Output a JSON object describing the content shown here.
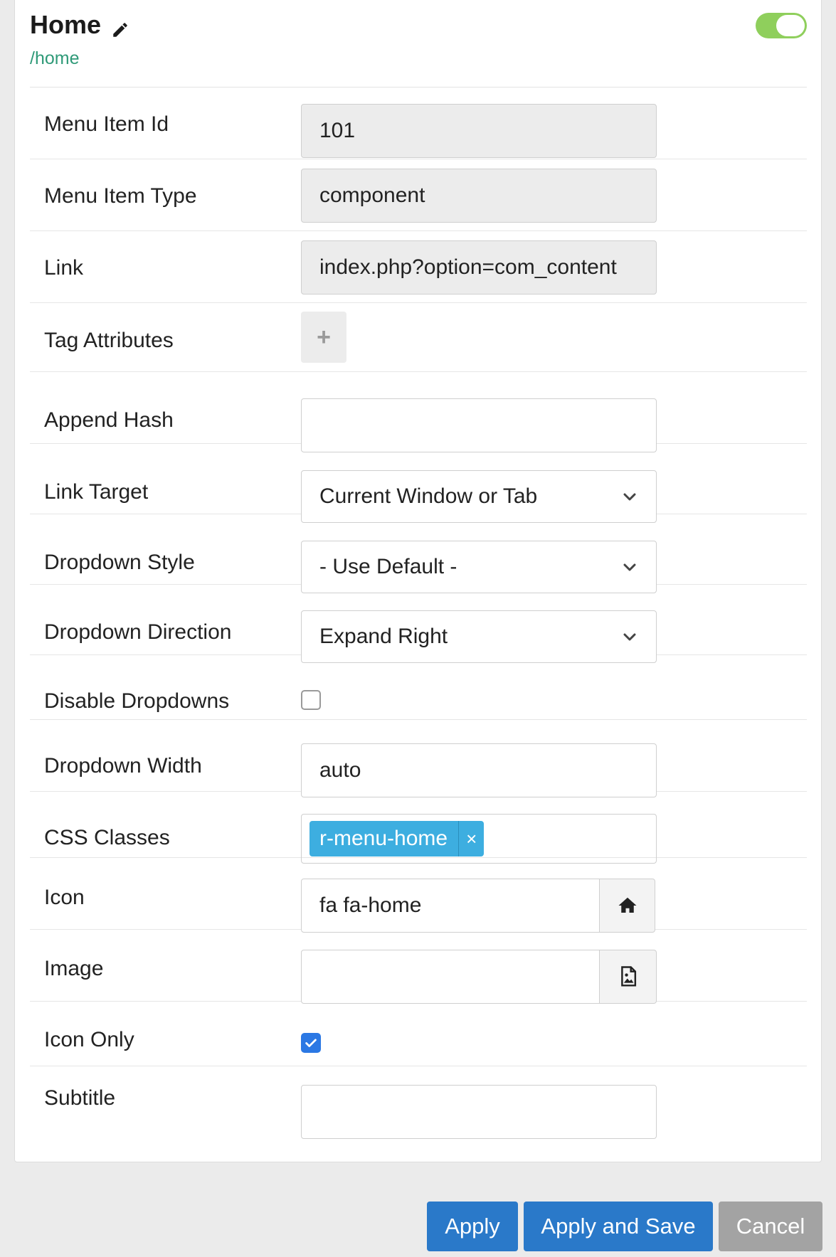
{
  "header": {
    "title": "Home",
    "path": "/home",
    "published": true
  },
  "fields": {
    "menu_item_id": {
      "label": "Menu Item Id",
      "value": "101"
    },
    "menu_item_type": {
      "label": "Menu Item Type",
      "value": "component"
    },
    "link": {
      "label": "Link",
      "value": "index.php?option=com_content"
    },
    "tag_attributes": {
      "label": "Tag Attributes",
      "add_label": "+"
    },
    "append_hash": {
      "label": "Append Hash",
      "value": ""
    },
    "link_target": {
      "label": "Link Target",
      "value": "Current Window or Tab"
    },
    "dropdown_style": {
      "label": "Dropdown Style",
      "value": "- Use Default -"
    },
    "dropdown_direction": {
      "label": "Dropdown Direction",
      "value": "Expand Right"
    },
    "disable_dropdowns": {
      "label": "Disable Dropdowns",
      "checked": false
    },
    "dropdown_width": {
      "label": "Dropdown Width",
      "value": "auto"
    },
    "css_classes": {
      "label": "CSS Classes",
      "tags": [
        "r-menu-home"
      ],
      "remove_label": "×"
    },
    "icon": {
      "label": "Icon",
      "value": "fa fa-home",
      "addon_icon": "home-icon"
    },
    "image": {
      "label": "Image",
      "value": "",
      "addon_icon": "image-icon"
    },
    "icon_only": {
      "label": "Icon Only",
      "checked": true
    },
    "subtitle": {
      "label": "Subtitle",
      "value": ""
    }
  },
  "footer": {
    "apply": "Apply",
    "apply_and_save": "Apply and Save",
    "cancel": "Cancel"
  },
  "colors": {
    "primary": "#2a79c9",
    "toggle_on": "#8fcf5c",
    "tag": "#3daee0",
    "path": "#2f9a78",
    "checkbox_checked": "#2b78e4"
  }
}
